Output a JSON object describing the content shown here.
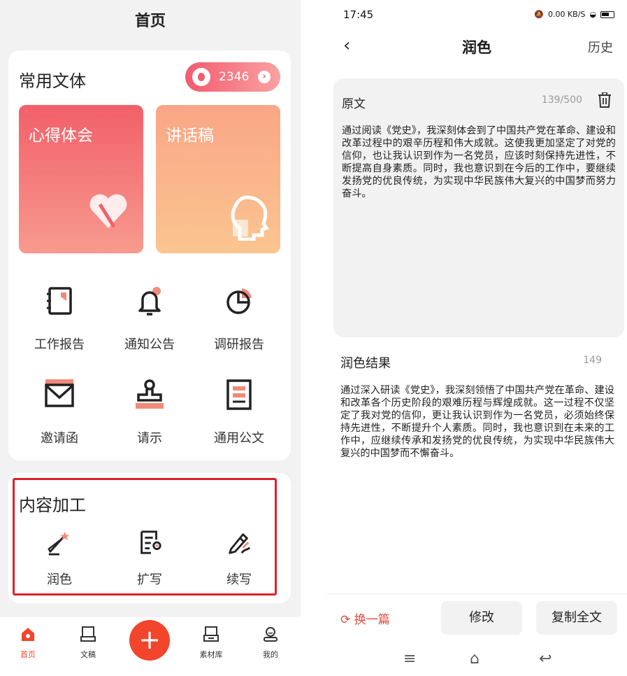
{
  "left": {
    "title": "首页",
    "common_section": {
      "title": "常用文体",
      "points": "2346"
    },
    "tiles": [
      {
        "label": "心得体会"
      },
      {
        "label": "讲话稿"
      }
    ],
    "grid": [
      {
        "label": "工作报告",
        "icon": "notebook-icon"
      },
      {
        "label": "通知公告",
        "icon": "bell-icon"
      },
      {
        "label": "调研报告",
        "icon": "pie-chart-icon"
      },
      {
        "label": "邀请函",
        "icon": "envelope-icon"
      },
      {
        "label": "请示",
        "icon": "stamp-icon"
      },
      {
        "label": "通用公文",
        "icon": "document-icon"
      }
    ],
    "process_section": {
      "title": "内容加工",
      "items": [
        {
          "label": "润色",
          "icon": "magic-wand-icon"
        },
        {
          "label": "扩写",
          "icon": "expand-doc-icon"
        },
        {
          "label": "续写",
          "icon": "pen-icon"
        }
      ]
    },
    "tabbar": [
      {
        "label": "首页",
        "icon": "home-icon",
        "active": true
      },
      {
        "label": "文稿",
        "icon": "drafts-icon"
      },
      {
        "label": "+",
        "icon": "plus-icon"
      },
      {
        "label": "素材库",
        "icon": "library-icon"
      },
      {
        "label": "我的",
        "icon": "profile-icon"
      }
    ],
    "colors": {
      "accent": "#f2452c",
      "tile1": "#f2606a",
      "tile2": "#f9b58a",
      "highlight_box": "#e0202a"
    }
  },
  "right": {
    "status": {
      "time": "17:45",
      "net_speed": "0.00 KB/S"
    },
    "nav": {
      "title": "润色",
      "history": "历史"
    },
    "original": {
      "label": "原文",
      "count": "139/500",
      "text": "通过阅读《党史》，我深刻体会到了中国共产党在革命、建设和改革过程中的艰辛历程和伟大成就。这使我更加坚定了对党的信仰，也让我认识到作为一名党员，应该时刻保持先进性，不断提高自身素质。同时，我也意识到在今后的工作中，要继续发扬党的优良传统，为实现中华民族伟大复兴的中国梦而努力奋斗。"
    },
    "result": {
      "label": "润色结果",
      "count": "149",
      "text": "通过深入研读《党史》，我深刻领悟了中国共产党在革命、建设和改革各个历史阶段的艰难历程与辉煌成就。这一过程不仅坚定了我对党的信仰，更让我认识到作为一名党员，必须始终保持先进性，不断提升个人素质。同时，我也意识到在未来的工作中，应继续传承和发扬党的优良传统，为实现中华民族伟大复兴的中国梦而不懈奋斗。"
    },
    "actions": {
      "swap": "换一篇",
      "edit": "修改",
      "copy": "复制全文"
    }
  }
}
